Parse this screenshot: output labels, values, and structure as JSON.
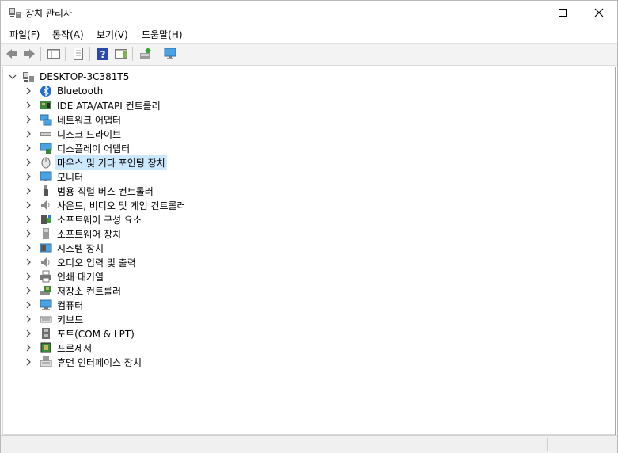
{
  "window": {
    "title": "장치 관리자"
  },
  "menu": [
    {
      "label": "파일(F)"
    },
    {
      "label": "동작(A)"
    },
    {
      "label": "보기(V)"
    },
    {
      "label": "도움말(H)"
    }
  ],
  "tree": {
    "root": "DESKTOP-3C381T5",
    "items": [
      {
        "label": "Bluetooth",
        "icon": "bluetooth-icon"
      },
      {
        "label": "IDE ATA/ATAPI 컨트롤러",
        "icon": "ide-controller-icon"
      },
      {
        "label": "네트워크 어댑터",
        "icon": "network-adapter-icon"
      },
      {
        "label": "디스크 드라이브",
        "icon": "disk-drive-icon"
      },
      {
        "label": "디스플레이 어댑터",
        "icon": "display-adapter-icon"
      },
      {
        "label": "마우스 및 기타 포인팅 장치",
        "icon": "mouse-icon",
        "selected": true
      },
      {
        "label": "모니터",
        "icon": "monitor-icon"
      },
      {
        "label": "범용 직렬 버스 컨트롤러",
        "icon": "usb-icon"
      },
      {
        "label": "사운드, 비디오 및 게임 컨트롤러",
        "icon": "speaker-icon"
      },
      {
        "label": "소프트웨어 구성 요소",
        "icon": "software-component-icon"
      },
      {
        "label": "소프트웨어 장치",
        "icon": "software-device-icon"
      },
      {
        "label": "시스템 장치",
        "icon": "system-device-icon"
      },
      {
        "label": "오디오 입력 및 출력",
        "icon": "audio-icon"
      },
      {
        "label": "인쇄 대기열",
        "icon": "printer-icon"
      },
      {
        "label": "저장소 컨트롤러",
        "icon": "storage-controller-icon"
      },
      {
        "label": "컴퓨터",
        "icon": "computer-icon"
      },
      {
        "label": "키보드",
        "icon": "keyboard-icon"
      },
      {
        "label": "포트(COM & LPT)",
        "icon": "port-icon"
      },
      {
        "label": "프로세서",
        "icon": "processor-icon"
      },
      {
        "label": "휴먼 인터페이스 장치",
        "icon": "hid-icon"
      }
    ]
  }
}
